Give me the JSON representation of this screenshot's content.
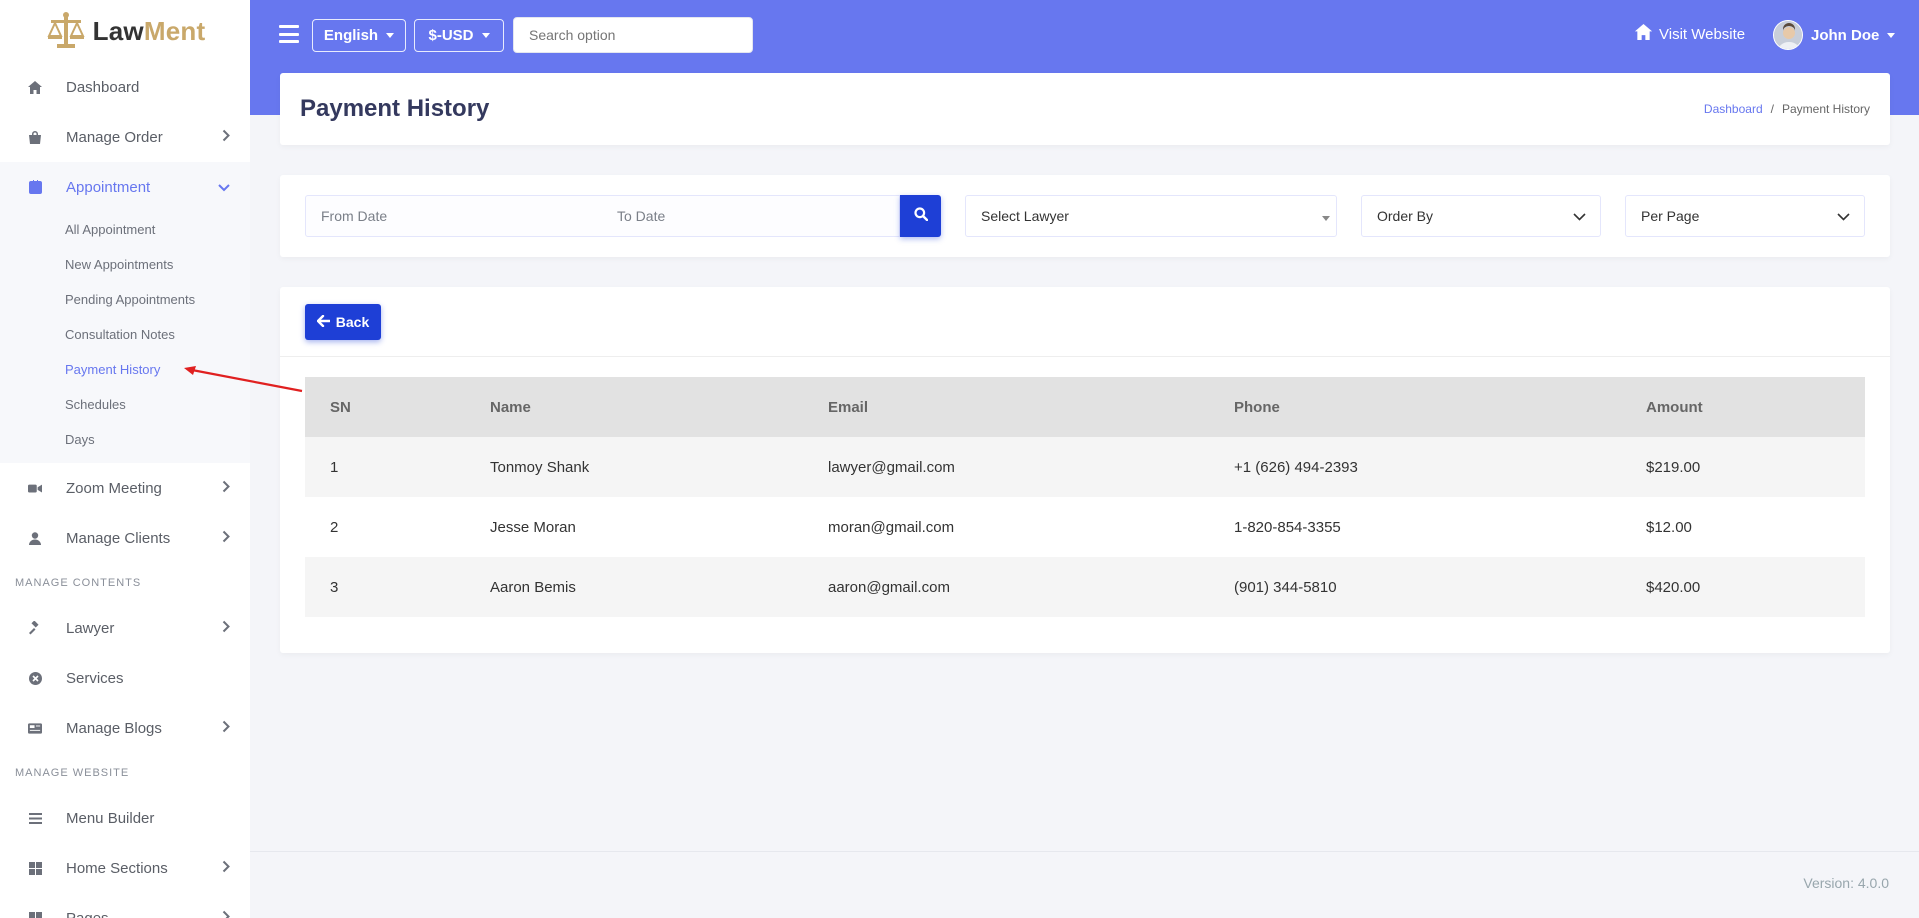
{
  "brand": {
    "name_part1": "Law",
    "name_part2": "Ment"
  },
  "sidebar": {
    "dashboard": "Dashboard",
    "manage_order": "Manage Order",
    "appointment": "Appointment",
    "appointment_sub": [
      "All Appointment",
      "New Appointments",
      "Pending Appointments",
      "Consultation Notes",
      "Payment History",
      "Schedules",
      "Days"
    ],
    "zoom_meeting": "Zoom Meeting",
    "manage_clients": "Manage Clients",
    "header_contents": "MANAGE CONTENTS",
    "lawyer": "Lawyer",
    "services": "Services",
    "manage_blogs": "Manage Blogs",
    "header_website": "MANAGE WEBSITE",
    "menu_builder": "Menu Builder",
    "home_sections": "Home Sections",
    "pages": "Pages"
  },
  "topbar": {
    "language": "English",
    "currency": "$-USD",
    "search_placeholder": "Search option",
    "visit_website": "Visit Website",
    "user_name": "John Doe"
  },
  "header": {
    "title": "Payment History",
    "breadcrumb_home": "Dashboard",
    "breadcrumb_current": "Payment History"
  },
  "filters": {
    "from_date_placeholder": "From Date",
    "to_date_placeholder": "To Date",
    "select_lawyer": "Select Lawyer",
    "order_by": "Order By",
    "per_page": "Per Page"
  },
  "table": {
    "back_label": "Back",
    "columns": {
      "sn": "SN",
      "name": "Name",
      "email": "Email",
      "phone": "Phone",
      "amount": "Amount"
    },
    "rows": [
      {
        "sn": "1",
        "name": "Tonmoy Shank",
        "email": "lawyer@gmail.com",
        "phone": "+1 (626) 494-2393",
        "amount": "$219.00"
      },
      {
        "sn": "2",
        "name": "Jesse Moran",
        "email": "moran@gmail.com",
        "phone": "1-820-854-3355",
        "amount": "$12.00"
      },
      {
        "sn": "3",
        "name": "Aaron Bemis",
        "email": "aaron@gmail.com",
        "phone": "(901) 344-5810",
        "amount": "$420.00"
      }
    ]
  },
  "footer": {
    "version": "Version: 4.0.0"
  },
  "colors": {
    "primary": "#6777ef",
    "button": "#1e3fd6",
    "brand_gold": "#c9a86a",
    "pointer": "#e02020"
  }
}
